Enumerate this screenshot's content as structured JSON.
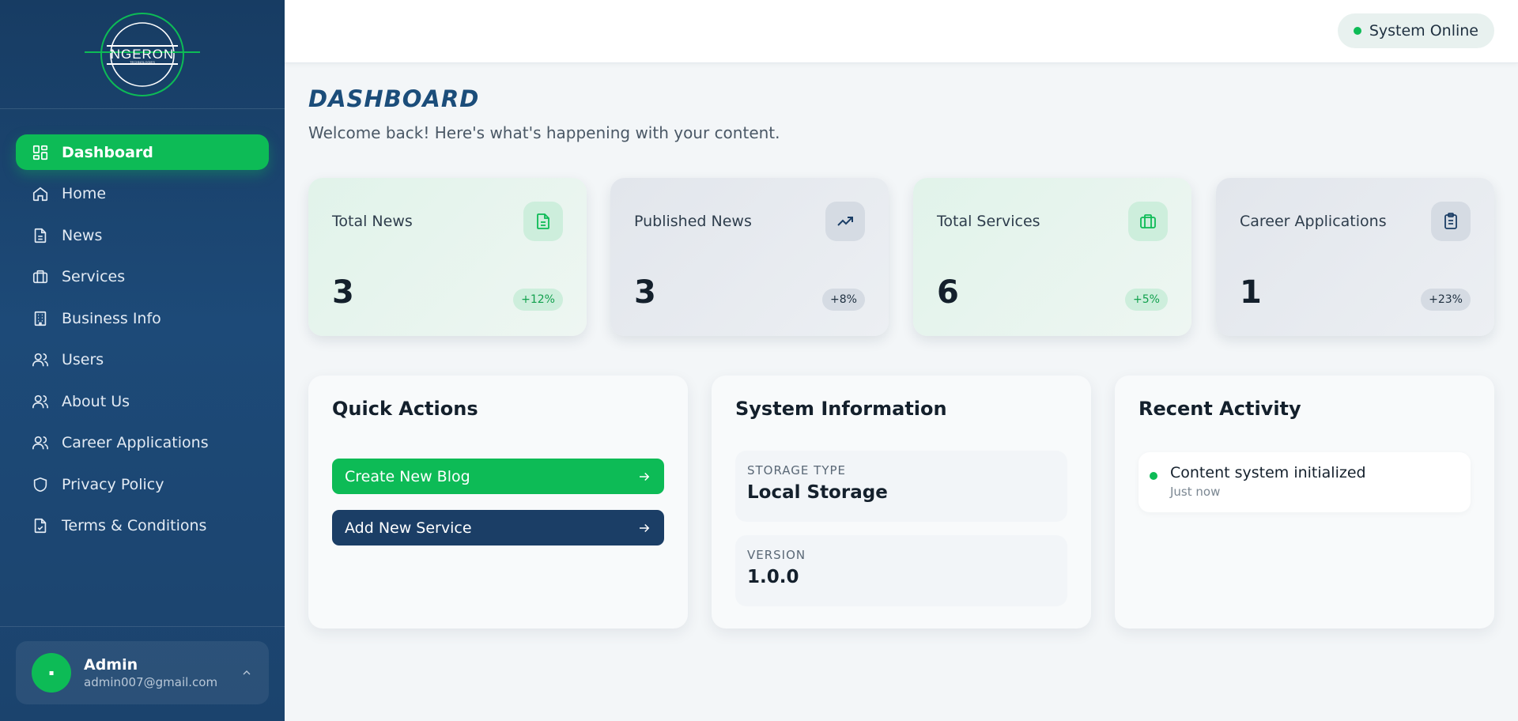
{
  "brand": {
    "logo_text": "NGERON",
    "logo_subtext": "TECHNOLOGIES"
  },
  "sidebar": {
    "items": [
      {
        "label": "Dashboard",
        "icon": "dashboard-icon",
        "active": true
      },
      {
        "label": "Home",
        "icon": "home-icon"
      },
      {
        "label": "News",
        "icon": "document-icon"
      },
      {
        "label": "Services",
        "icon": "briefcase-icon"
      },
      {
        "label": "Business Info",
        "icon": "building-icon"
      },
      {
        "label": "Users",
        "icon": "users-icon"
      },
      {
        "label": "About Us",
        "icon": "users-icon"
      },
      {
        "label": "Career Applications",
        "icon": "users-icon"
      },
      {
        "label": "Privacy Policy",
        "icon": "shield-icon"
      },
      {
        "label": "Terms & Conditions",
        "icon": "file-check-icon"
      }
    ],
    "user": {
      "name": "Admin",
      "email": "admin007@gmail.com"
    }
  },
  "topbar": {
    "status": "System Online"
  },
  "main": {
    "title": "DASHBOARD",
    "subtitle": "Welcome back! Here's what's happening with your content.",
    "stats": [
      {
        "label": "Total News",
        "value": "3",
        "change": "+12%",
        "icon": "file-text-icon",
        "tone": "green"
      },
      {
        "label": "Published News",
        "value": "3",
        "change": "+8%",
        "icon": "trending-up-icon",
        "tone": "grey"
      },
      {
        "label": "Total Services",
        "value": "6",
        "change": "+5%",
        "icon": "briefcase-icon",
        "tone": "green"
      },
      {
        "label": "Career Applications",
        "value": "1",
        "change": "+23%",
        "icon": "clipboard-icon",
        "tone": "grey"
      }
    ],
    "quick_actions": {
      "title": "Quick Actions",
      "buttons": [
        {
          "label": "Create New Blog"
        },
        {
          "label": "Add New Service"
        }
      ]
    },
    "system_info": {
      "title": "System Information",
      "storage_label": "STORAGE TYPE",
      "storage_value": "Local Storage",
      "version_label": "VERSION",
      "version_value": "1.0.0"
    },
    "recent_activity": {
      "title": "Recent Activity",
      "items": [
        {
          "text": "Content system initialized",
          "time": "Just now"
        }
      ]
    }
  },
  "colors": {
    "accent": "#0dbb56",
    "navy": "#1b3e66",
    "sidebar": "#1d4a78"
  }
}
